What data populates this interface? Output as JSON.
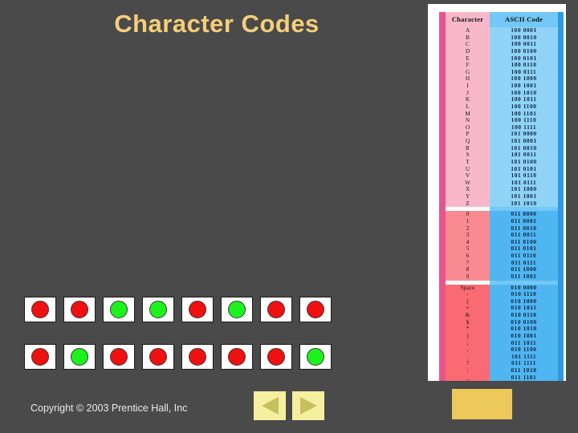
{
  "slide": {
    "title": "Character Codes",
    "background_color": "#4a4a4a",
    "title_color": "#f5ce7a"
  },
  "ascii_table": {
    "headers": {
      "character": "Character",
      "code": "ASCII Code"
    },
    "sections": [
      {
        "name": "letters",
        "char_bg": "#f9b8ca",
        "code_bg": "#8fd3f7",
        "rows": [
          {
            "character": "A",
            "code": "100 0001"
          },
          {
            "character": "B",
            "code": "100 0010"
          },
          {
            "character": "C",
            "code": "100 0011"
          },
          {
            "character": "D",
            "code": "100 0100"
          },
          {
            "character": "E",
            "code": "100 0101"
          },
          {
            "character": "F",
            "code": "100 0110"
          },
          {
            "character": "G",
            "code": "100 0111"
          },
          {
            "character": "H",
            "code": "100 1000"
          },
          {
            "character": "I",
            "code": "100 1001"
          },
          {
            "character": "J",
            "code": "100 1010"
          },
          {
            "character": "K",
            "code": "100 1011"
          },
          {
            "character": "L",
            "code": "100 1100"
          },
          {
            "character": "M",
            "code": "100 1101"
          },
          {
            "character": "N",
            "code": "100 1110"
          },
          {
            "character": "O",
            "code": "100 1111"
          },
          {
            "character": "P",
            "code": "101 0000"
          },
          {
            "character": "Q",
            "code": "101 0001"
          },
          {
            "character": "R",
            "code": "101 0010"
          },
          {
            "character": "S",
            "code": "101 0011"
          },
          {
            "character": "T",
            "code": "101 0100"
          },
          {
            "character": "U",
            "code": "101 0101"
          },
          {
            "character": "V",
            "code": "101 0110"
          },
          {
            "character": "W",
            "code": "101 0111"
          },
          {
            "character": "X",
            "code": "101 1000"
          },
          {
            "character": "Y",
            "code": "101 1001"
          },
          {
            "character": "Z",
            "code": "101 1010"
          }
        ]
      },
      {
        "name": "digits",
        "char_bg": "#f98a92",
        "code_bg": "#4fb6f2",
        "rows": [
          {
            "character": "0",
            "code": "011 0000"
          },
          {
            "character": "1",
            "code": "011 0001"
          },
          {
            "character": "2",
            "code": "011 0010"
          },
          {
            "character": "3",
            "code": "011 0011"
          },
          {
            "character": "4",
            "code": "011 0100"
          },
          {
            "character": "5",
            "code": "011 0101"
          },
          {
            "character": "6",
            "code": "011 0110"
          },
          {
            "character": "7",
            "code": "011 0111"
          },
          {
            "character": "8",
            "code": "011 1000"
          },
          {
            "character": "9",
            "code": "011 1001"
          }
        ]
      },
      {
        "name": "symbols",
        "char_bg": "#f96a72",
        "code_bg": "#4fb6f2",
        "rows": [
          {
            "character": "Space",
            "code": "010 0000"
          },
          {
            "character": "-",
            "code": "010 1110"
          },
          {
            "character": "(",
            "code": "010 1000"
          },
          {
            "character": "+",
            "code": "010 1011"
          },
          {
            "character": "&",
            "code": "010 0110"
          },
          {
            "character": "$",
            "code": "010 0100"
          },
          {
            "character": "*",
            "code": "010 1010"
          },
          {
            "character": ")",
            "code": "010 1001"
          },
          {
            "character": ";",
            "code": "011 1011"
          },
          {
            "character": ",",
            "code": "010 1100"
          },
          {
            "character": ".",
            "code": "101 1111"
          },
          {
            "character": "?",
            "code": "011 1111"
          },
          {
            "character": ":",
            "code": "011 1010"
          },
          {
            "character": "_",
            "code": "011 1101"
          }
        ]
      }
    ]
  },
  "signal_rows": [
    {
      "name": "row-1",
      "cells": [
        "red",
        "red",
        "green",
        "green",
        "red",
        "green",
        "red",
        "red"
      ]
    },
    {
      "name": "row-2",
      "cells": [
        "red",
        "green",
        "red",
        "red",
        "red",
        "red",
        "red",
        "green"
      ]
    }
  ],
  "footer": {
    "copyright": "Copyright © 2003 Prentice Hall, Inc",
    "prev_label": "Previous slide",
    "next_label": "Next slide"
  }
}
